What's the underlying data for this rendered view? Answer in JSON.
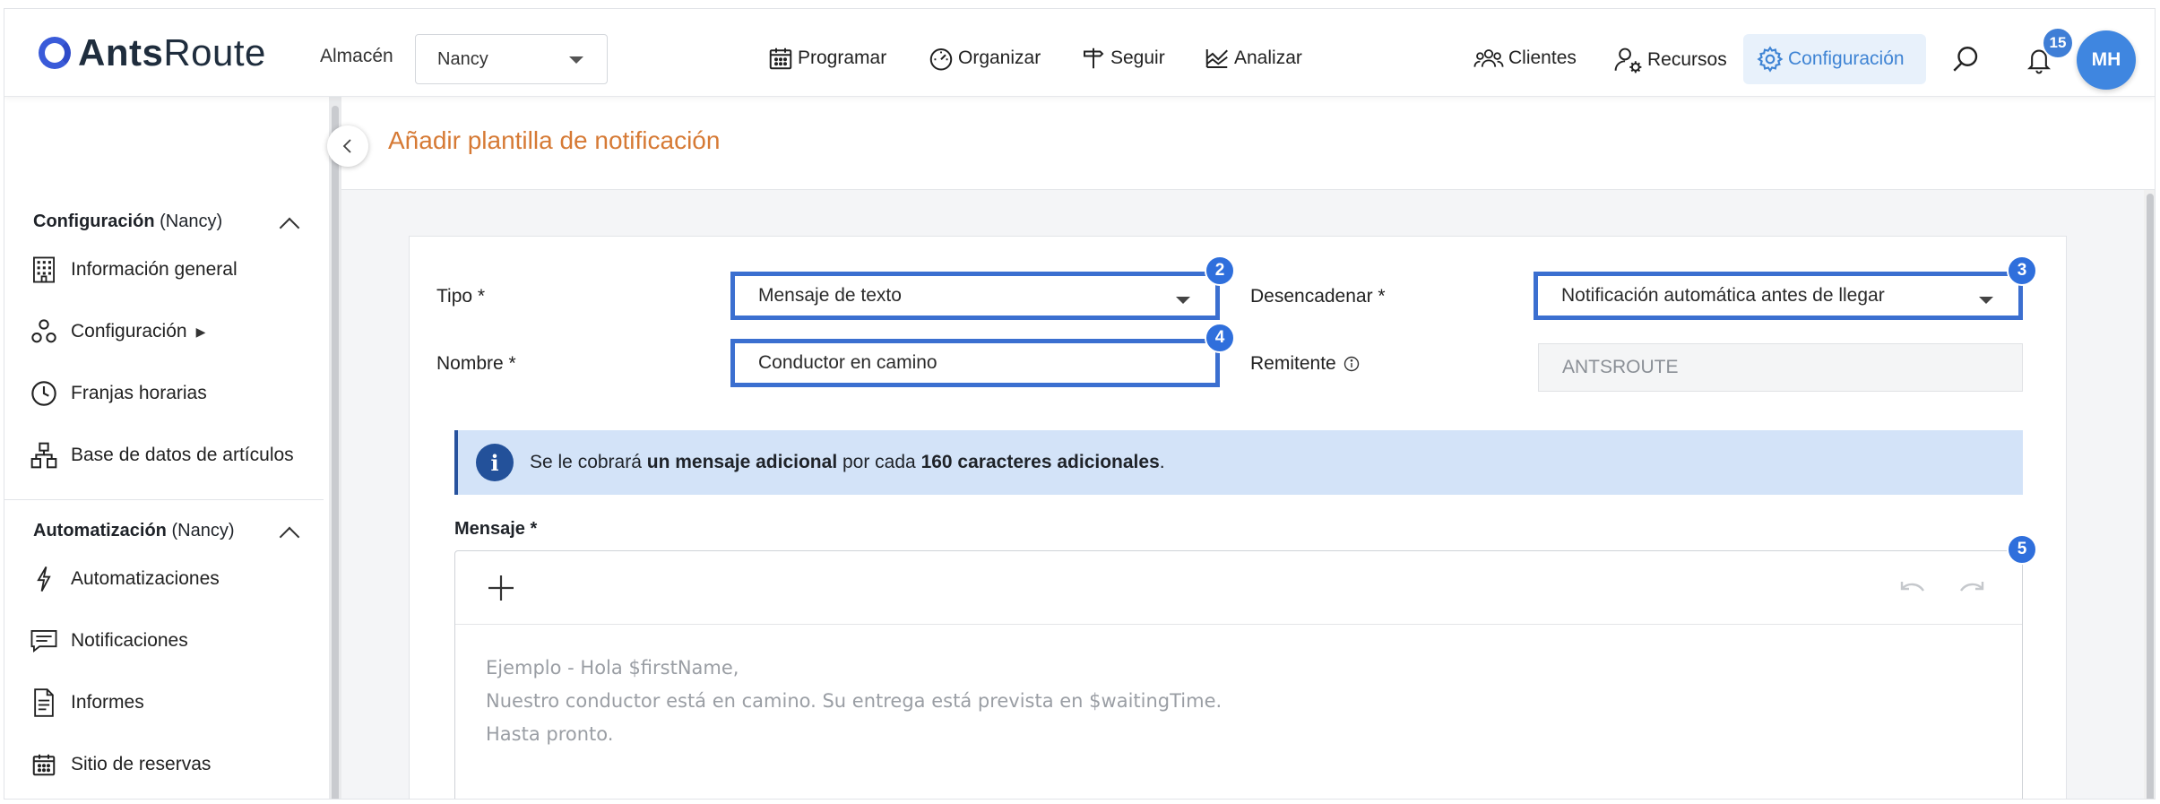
{
  "header": {
    "logo_bold": "Ants",
    "logo_light": "Route",
    "warehouse_label": "Almacén",
    "warehouse_value": "Nancy",
    "nav": {
      "programar": "Programar",
      "organizar": "Organizar",
      "seguir": "Seguir",
      "analizar": "Analizar",
      "clientes": "Clientes",
      "recursos": "Recursos",
      "configuracion": "Configuración"
    },
    "notification_count": "15",
    "avatar_initials": "MH"
  },
  "sidebar": {
    "section1_title": "Configuración",
    "section1_scope": "(Nancy)",
    "items1": [
      "Información general",
      "Configuración",
      "Franjas horarias",
      "Base de datos de artículos"
    ],
    "section2_title": "Automatización",
    "section2_scope": "(Nancy)",
    "items2": [
      "Automatizaciones",
      "Notificaciones",
      "Informes",
      "Sitio de reservas"
    ]
  },
  "page": {
    "title": "Añadir plantilla de notificación"
  },
  "form": {
    "tipo_label": "Tipo *",
    "tipo_value": "Mensaje de texto",
    "desencadenar_label": "Desencadenar *",
    "desencadenar_value": "Notificación automática antes de llegar",
    "nombre_label": "Nombre *",
    "nombre_value": "Conductor en camino",
    "remitente_label": "Remitente",
    "remitente_value": "ANTSROUTE",
    "badges": [
      "2",
      "3",
      "4",
      "5"
    ],
    "info_text_1": "Se le cobrará ",
    "info_bold_1": "un mensaje adicional",
    "info_text_2": " por cada ",
    "info_bold_2": "160 caracteres adicionales",
    "info_text_3": ".",
    "mensaje_label": "Mensaje *",
    "mensaje_placeholder_lines": [
      "Ejemplo - Hola $firstName,",
      "Nuestro conductor está en camino. Su entrega está prevista en $waitingTime.",
      "Hasta pronto."
    ]
  },
  "colors": {
    "accent": "#3f84d4",
    "title_orange": "#d67a35",
    "highlight_border": "#3b6fd0",
    "info_bg": "#d3e3f8"
  }
}
